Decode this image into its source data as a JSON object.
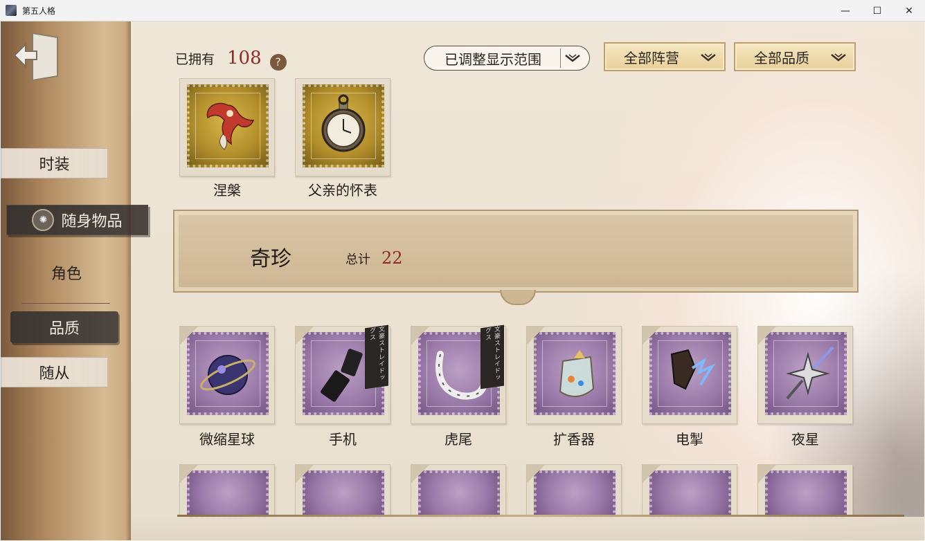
{
  "window": {
    "title": "第五人格",
    "controls": {
      "minimize": "—",
      "maximize": "☐",
      "close": "✕"
    }
  },
  "sidebar": {
    "tabs": [
      {
        "label": "时装",
        "active": false
      },
      {
        "label": "随身物品",
        "active": true
      },
      {
        "label": "随从",
        "active": false
      }
    ],
    "filters": [
      {
        "label": "角色",
        "active": false
      },
      {
        "label": "品质",
        "active": true
      }
    ]
  },
  "header": {
    "owned_label": "已拥有",
    "owned_count": "108",
    "help_icon": "?",
    "range_select": "已调整显示范围",
    "faction_select": "全部阵营",
    "quality_select": "全部品质"
  },
  "top_items": [
    {
      "name": "涅槃",
      "icon": "phoenix-icon",
      "stamp": "gold"
    },
    {
      "name": "父亲的怀表",
      "icon": "pocket-watch-icon",
      "stamp": "gold"
    }
  ],
  "section": {
    "title": "奇珍",
    "total_label": "总计",
    "total_count": "22"
  },
  "grid_items": [
    {
      "name": "微缩星球",
      "icon": "mini-planet-icon",
      "ribbon": ""
    },
    {
      "name": "手机",
      "icon": "flip-phone-icon",
      "ribbon": "文豪ストレイドッグス"
    },
    {
      "name": "虎尾",
      "icon": "tiger-tail-icon",
      "ribbon": "文豪ストレイドッグス"
    },
    {
      "name": "扩香器",
      "icon": "diffuser-icon",
      "ribbon": ""
    },
    {
      "name": "电掣",
      "icon": "lightning-glove-icon",
      "ribbon": ""
    },
    {
      "name": "夜星",
      "icon": "night-star-icon",
      "ribbon": ""
    }
  ],
  "colors": {
    "accent_red": "#8c2a25",
    "dark_tab": "#3a3430",
    "gold_stamp": "#d9b84a",
    "purple_stamp": "#9a7aa8"
  }
}
